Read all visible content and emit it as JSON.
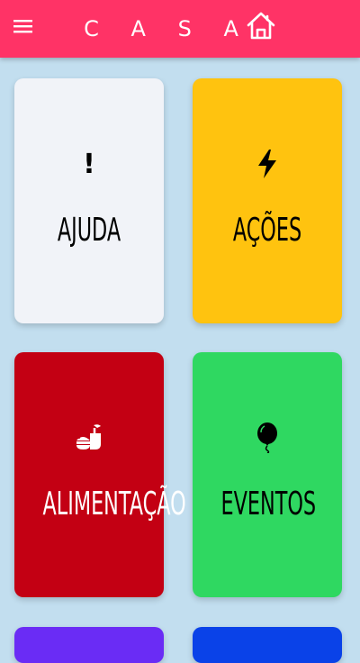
{
  "appbar": {
    "title": "C A S A",
    "menu_icon": "hamburger-menu-icon",
    "home_icon": "home-icon"
  },
  "cards": [
    {
      "label": "AJUDA",
      "icon": "exclamation-icon",
      "icon_text": "!",
      "color": "#f1f3f8"
    },
    {
      "label": "AÇÕES",
      "icon": "lightning-bolt-icon",
      "color": "#ffc30f"
    },
    {
      "label": "ALIMENTAÇÃO",
      "icon": "food-icon",
      "color": "#c30013"
    },
    {
      "label": "EVENTOS",
      "icon": "balloon-icon",
      "color": "#2fd861"
    },
    {
      "label": "",
      "color": "#6a2cf5"
    },
    {
      "label": "",
      "color": "#0a42e8"
    }
  ]
}
